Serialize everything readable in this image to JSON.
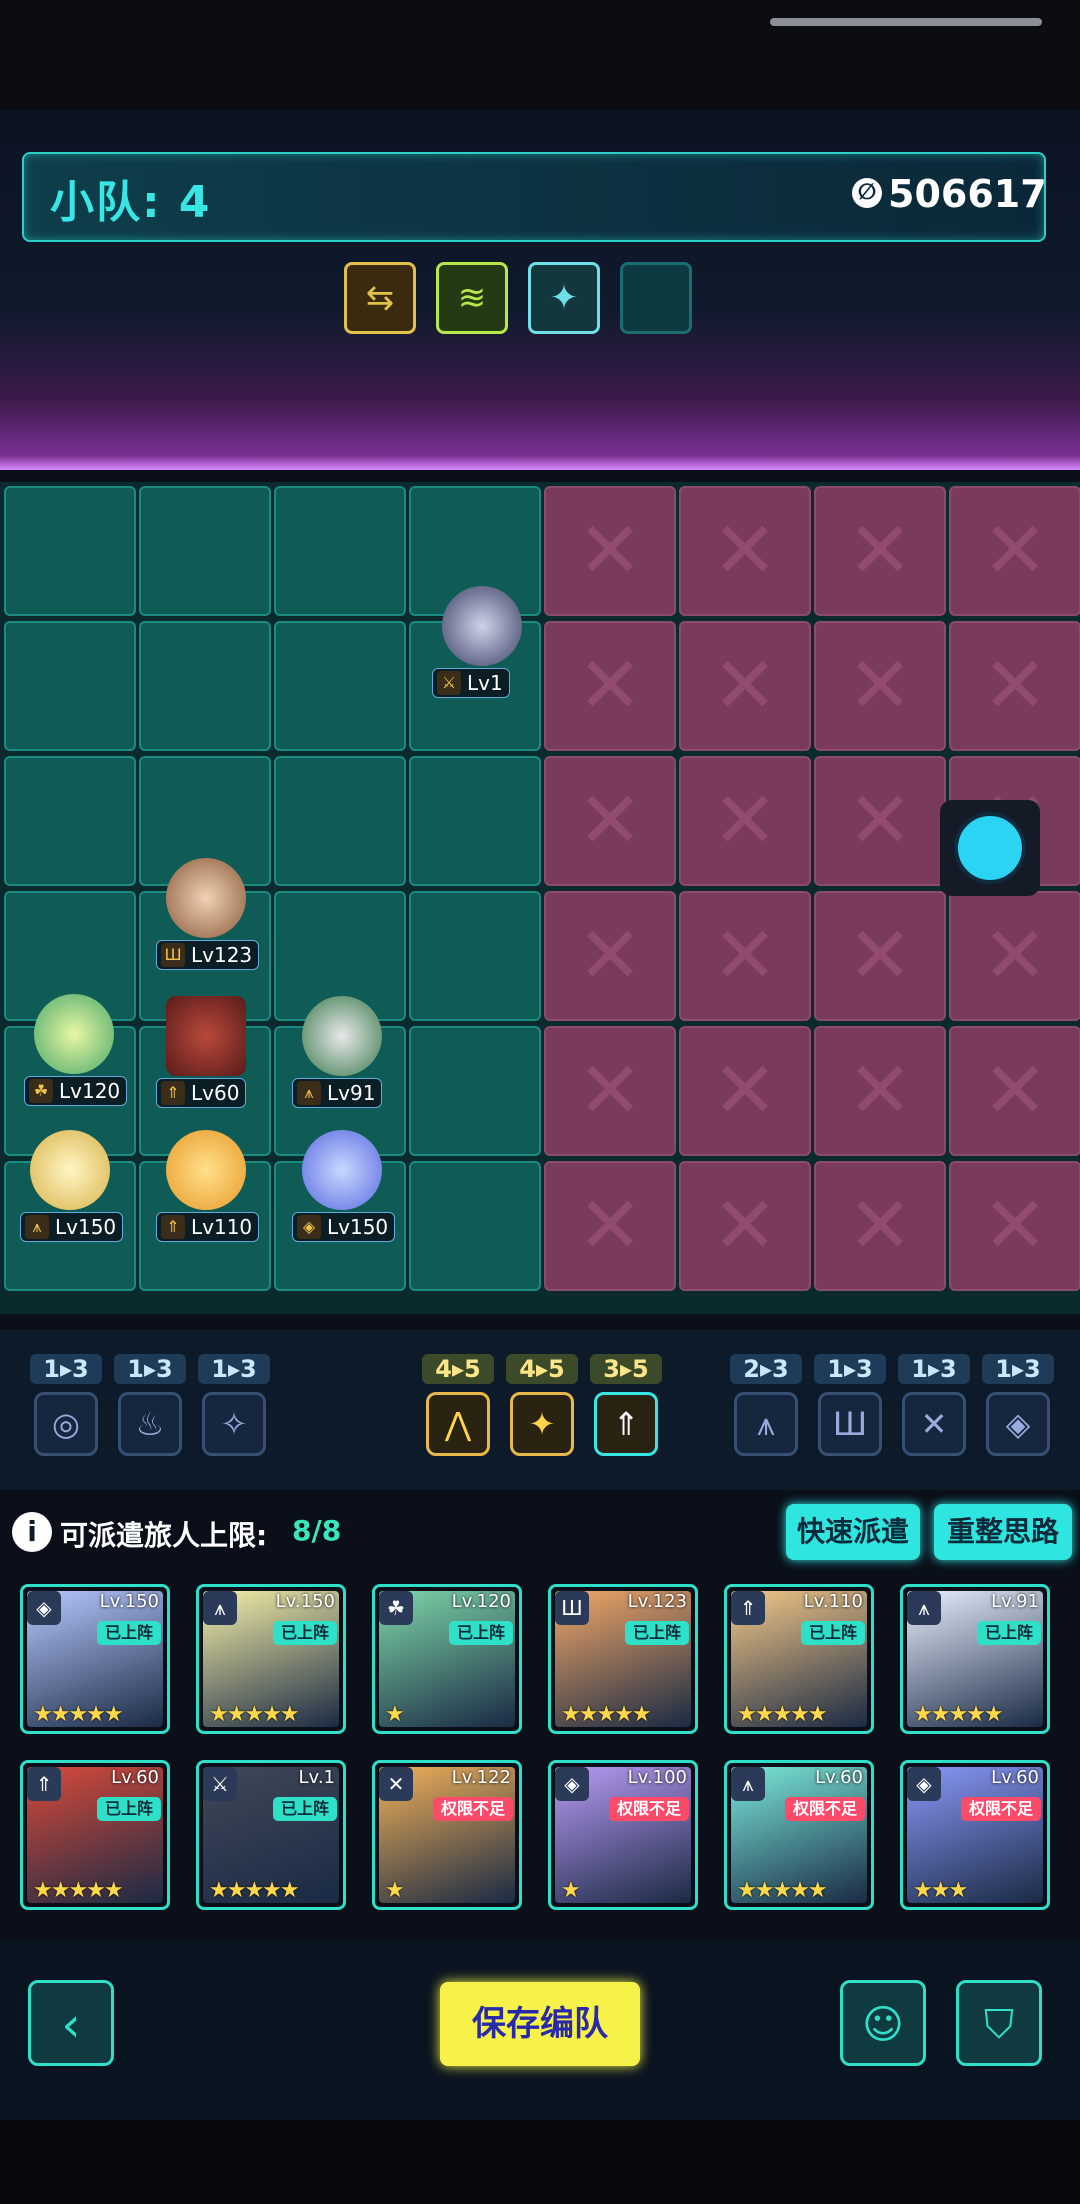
{
  "header": {
    "squad_label": "小队: 4",
    "currency_icon": "∅",
    "currency_value": "506617"
  },
  "buffs": [
    {
      "icon": "⇆",
      "color": "#e2c14a"
    },
    {
      "icon": "≋",
      "color": "#b6e84a"
    },
    {
      "icon": "✦",
      "color": "#6fe0e8"
    },
    {
      "icon": "",
      "color": "#1c6d72"
    }
  ],
  "board_units": [
    {
      "name": "unit-lv1",
      "level": "Lv1",
      "cls": "⚔"
    },
    {
      "name": "unit-lv123",
      "level": "Lv123",
      "cls": "Ш"
    },
    {
      "name": "unit-lv120",
      "level": "Lv120",
      "cls": "☘"
    },
    {
      "name": "unit-lv60",
      "level": "Lv60",
      "cls": "⇑"
    },
    {
      "name": "unit-lv91",
      "level": "Lv91",
      "cls": "⩚"
    },
    {
      "name": "unit-lv150-a",
      "level": "Lv150",
      "cls": "⩚"
    },
    {
      "name": "unit-lv110",
      "level": "Lv110",
      "cls": "⇑"
    },
    {
      "name": "unit-lv150-b",
      "level": "Lv150",
      "cls": "◈"
    }
  ],
  "synergies": [
    {
      "count": "1▸3",
      "icon": "◎"
    },
    {
      "count": "1▸3",
      "icon": "♨"
    },
    {
      "count": "1▸3",
      "icon": "✧"
    },
    {
      "count": "4▸5",
      "icon": "⋀"
    },
    {
      "count": "4▸5",
      "icon": "✦"
    },
    {
      "count": "3▸5",
      "icon": "⇑"
    },
    {
      "count": "2▸3",
      "icon": "⩚"
    },
    {
      "count": "1▸3",
      "icon": "Ш"
    },
    {
      "count": "1▸3",
      "icon": "✕"
    },
    {
      "count": "1▸3",
      "icon": "◈"
    }
  ],
  "dispatch": {
    "label": "可派遣旅人上限:",
    "count": "8/8",
    "quick_dispatch": "快速派遣",
    "rearrange": "重整思路"
  },
  "roster": [
    {
      "level": "Lv.150",
      "tag": "已上阵",
      "stars": "★★★★★",
      "cls": "◈"
    },
    {
      "level": "Lv.150",
      "tag": "已上阵",
      "stars": "★★★★★",
      "cls": "⩚"
    },
    {
      "level": "Lv.120",
      "tag": "已上阵",
      "stars": "★",
      "cls": "☘"
    },
    {
      "level": "Lv.123",
      "tag": "已上阵",
      "stars": "★★★★★",
      "cls": "Ш"
    },
    {
      "level": "Lv.110",
      "tag": "已上阵",
      "stars": "★★★★★",
      "cls": "⇑"
    },
    {
      "level": "Lv.91",
      "tag": "已上阵",
      "stars": "★★★★★",
      "cls": "⩚"
    },
    {
      "level": "Lv.60",
      "tag": "已上阵",
      "stars": "★★★★★",
      "cls": "⇑"
    },
    {
      "level": "Lv.1",
      "tag": "已上阵",
      "stars": "★★★★★",
      "cls": "⚔"
    },
    {
      "level": "Lv.122",
      "tag": "权限不足",
      "stars": "★",
      "cls": "✕"
    },
    {
      "level": "Lv.100",
      "tag": "权限不足",
      "stars": "★",
      "cls": "◈"
    },
    {
      "level": "Lv.60",
      "tag": "权限不足",
      "stars": "★★★★★",
      "cls": "⩚"
    },
    {
      "level": "Lv.60",
      "tag": "权限不足",
      "stars": "★★★",
      "cls": "◈"
    }
  ],
  "bottom": {
    "back_icon": "‹",
    "save_label": "保存编队",
    "brain_icon": "☺",
    "filter_icon": "⛉"
  }
}
